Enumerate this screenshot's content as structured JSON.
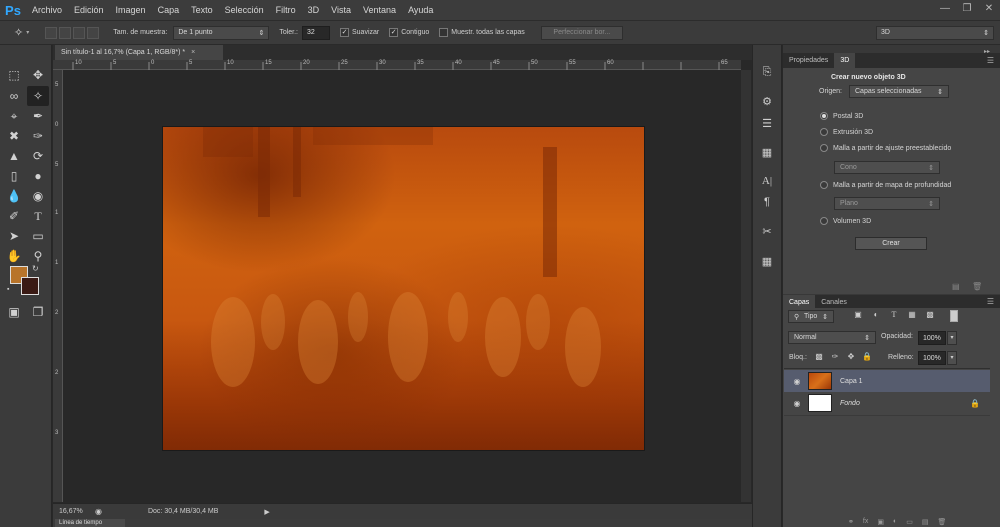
{
  "app": {
    "logo": "Ps",
    "menu": [
      "Archivo",
      "Edición",
      "Imagen",
      "Capa",
      "Texto",
      "Selección",
      "Filtro",
      "3D",
      "Vista",
      "Ventana",
      "Ayuda"
    ],
    "window_controls": [
      "minimize-icon",
      "restore-icon",
      "close-icon"
    ]
  },
  "options": {
    "sample_size_label": "Tam. de muestra:",
    "sample_size_value": "De 1 punto",
    "tolerance_label": "Toler.:",
    "tolerance_value": "32",
    "antialias_label": "Suavizar",
    "contiguous_label": "Contiguo",
    "sample_all_layers_label": "Muestr. todas las capas",
    "refine_edge_label": "Perfeccionar bor...",
    "workspace_value": "3D"
  },
  "document": {
    "tab_title": "Sin título-1 al 16,7% (Capa 1, RGB/8*) *",
    "tab_close": "×",
    "ruler_top_ticks": [
      "10",
      "5",
      "0",
      "5",
      "10",
      "15",
      "20",
      "25",
      "30",
      "35",
      "40",
      "45",
      "50",
      "55",
      "60",
      "65"
    ],
    "ruler_left_ticks": [
      "5",
      "0",
      "5",
      "1",
      "1",
      "2",
      "2",
      "3"
    ],
    "zoom": "16,67%",
    "doc_info": "Doc: 30,4 MB/30,4 MB",
    "timeline_tab": "Línea de tiempo"
  },
  "properties": {
    "tabs": [
      "Propiedades",
      "3D"
    ],
    "title": "Crear nuevo objeto 3D",
    "origin_label": "Origen:",
    "origin_value": "Capas seleccionadas",
    "options": [
      {
        "label": "Postal 3D",
        "selected": true
      },
      {
        "label": "Extrusión 3D",
        "selected": false
      },
      {
        "label": "Malla a partir de ajuste preestablecido",
        "selected": false
      },
      {
        "label": "Malla a partir de mapa de profundidad",
        "selected": false
      },
      {
        "label": "Volumen 3D",
        "selected": false
      }
    ],
    "preset_value": "Cono",
    "depth_value": "Plano",
    "create_button": "Crear"
  },
  "layers": {
    "tabs": [
      "Capas",
      "Canales"
    ],
    "filter_value": "Tipo",
    "blend_mode": "Normal",
    "opacity_label": "Opacidad:",
    "opacity_value": "100%",
    "lock_label": "Bloq.:",
    "fill_label": "Relleno:",
    "fill_value": "100%",
    "items": [
      {
        "name": "Capa 1",
        "selected": true
      },
      {
        "name": "Fondo",
        "selected": false
      }
    ]
  },
  "colors": {
    "foreground": "#b8742a",
    "background": "#3a1a14",
    "selection": "#565c6e",
    "brand": "#31a8ff"
  }
}
